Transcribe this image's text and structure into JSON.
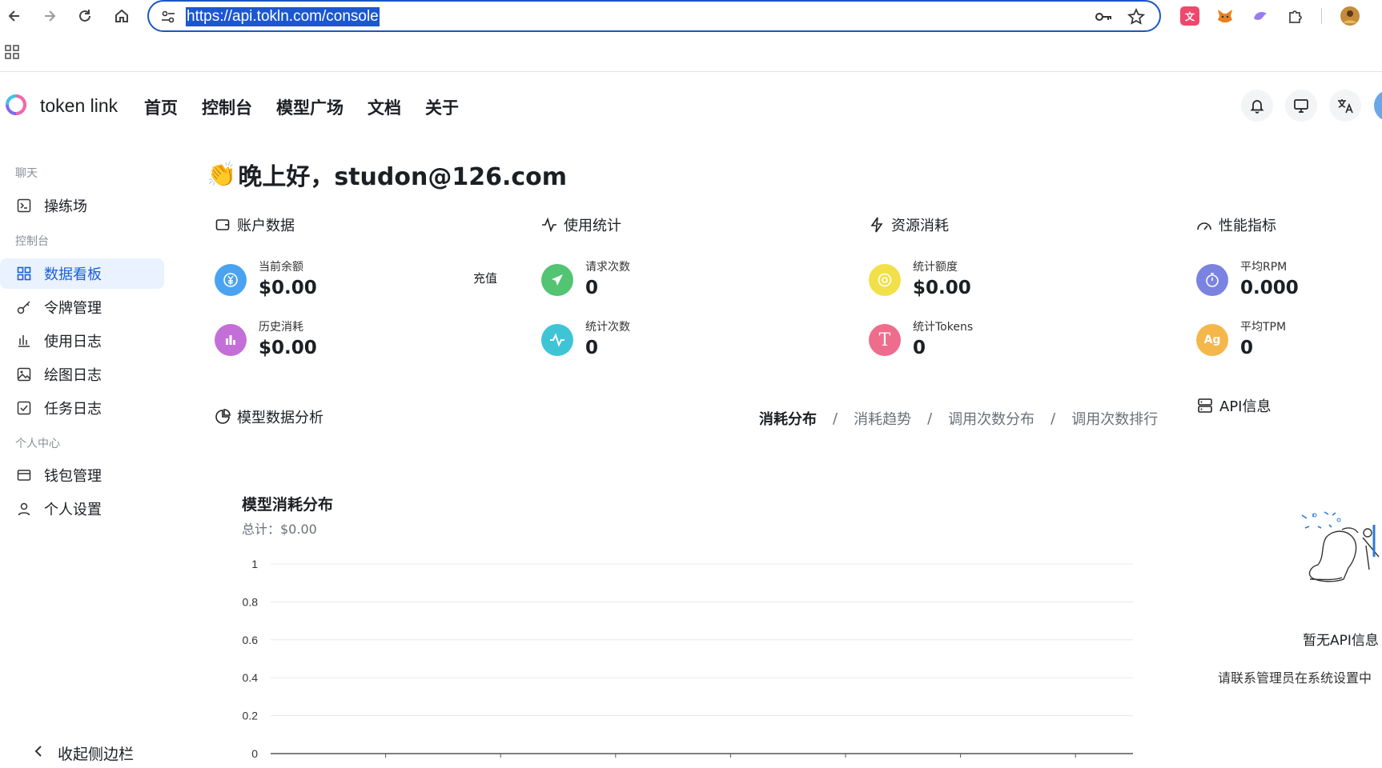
{
  "browser": {
    "url": "https://api.tokln.com/console"
  },
  "header": {
    "brand": "token link",
    "nav": [
      "首页",
      "控制台",
      "模型广场",
      "文档",
      "关于"
    ]
  },
  "sidebar": {
    "groups": [
      "聊天",
      "控制台",
      "个人中心"
    ],
    "items": [
      {
        "label": "操练场",
        "icon": "terminal-icon"
      },
      {
        "label": "数据看板",
        "icon": "dashboard-icon",
        "active": true
      },
      {
        "label": "令牌管理",
        "icon": "key-icon"
      },
      {
        "label": "使用日志",
        "icon": "bar-chart-icon"
      },
      {
        "label": "绘图日志",
        "icon": "image-icon"
      },
      {
        "label": "任务日志",
        "icon": "checkbox-icon"
      },
      {
        "label": "钱包管理",
        "icon": "wallet-icon"
      },
      {
        "label": "个人设置",
        "icon": "user-icon"
      }
    ],
    "collapse_label": "收起侧边栏"
  },
  "main": {
    "greeting": "晚上好，studon@126.com",
    "greeting_emoji": "👏",
    "cards": [
      {
        "title": "账户数据",
        "icon": "wallet-icon",
        "stats": [
          {
            "label": "当前余额",
            "value": "$0.00",
            "color": "#4aa3f0",
            "icon": "yen-coin-icon"
          },
          {
            "label": "历史消耗",
            "value": "$0.00",
            "color": "#c46fd8",
            "icon": "bar-chart-icon"
          }
        ],
        "action": "充值"
      },
      {
        "title": "使用统计",
        "icon": "pulse-icon",
        "stats": [
          {
            "label": "请求次数",
            "value": "0",
            "color": "#52c472",
            "icon": "send-icon"
          },
          {
            "label": "统计次数",
            "value": "0",
            "color": "#3fc4d6",
            "icon": "pulse-icon"
          }
        ]
      },
      {
        "title": "资源消耗",
        "icon": "lightning-icon",
        "stats": [
          {
            "label": "统计额度",
            "value": "$0.00",
            "color": "#f2e04a",
            "icon": "coin-icon"
          },
          {
            "label": "统计Tokens",
            "value": "0",
            "color": "#ee6c8c",
            "icon": "letter-t-icon",
            "glyph": "T"
          }
        ]
      },
      {
        "title": "性能指标",
        "icon": "gauge-icon",
        "stats": [
          {
            "label": "平均RPM",
            "value": "0.000",
            "color": "#7b83e0",
            "icon": "stopwatch-icon"
          },
          {
            "label": "平均TPM",
            "value": "0",
            "color": "#f5b64a",
            "icon": "ag-icon",
            "glyph": "Ag"
          }
        ]
      }
    ],
    "analysis": {
      "title": "模型数据分析",
      "tabs": [
        "消耗分布",
        "消耗趋势",
        "调用次数分布",
        "调用次数排行"
      ],
      "active_tab": 0
    },
    "api_info": {
      "title": "API信息",
      "empty_title": "暂无API信息",
      "empty_desc": "请联系管理员在系统设置中"
    }
  },
  "chart_data": {
    "type": "bar",
    "title": "模型消耗分布",
    "subtitle": "总计：$0.00",
    "categories": [],
    "values": [],
    "ylim": [
      0,
      1
    ],
    "yticks": [
      "1",
      "0.8",
      "0.6",
      "0.4",
      "0.2",
      "0"
    ],
    "grid": true
  }
}
